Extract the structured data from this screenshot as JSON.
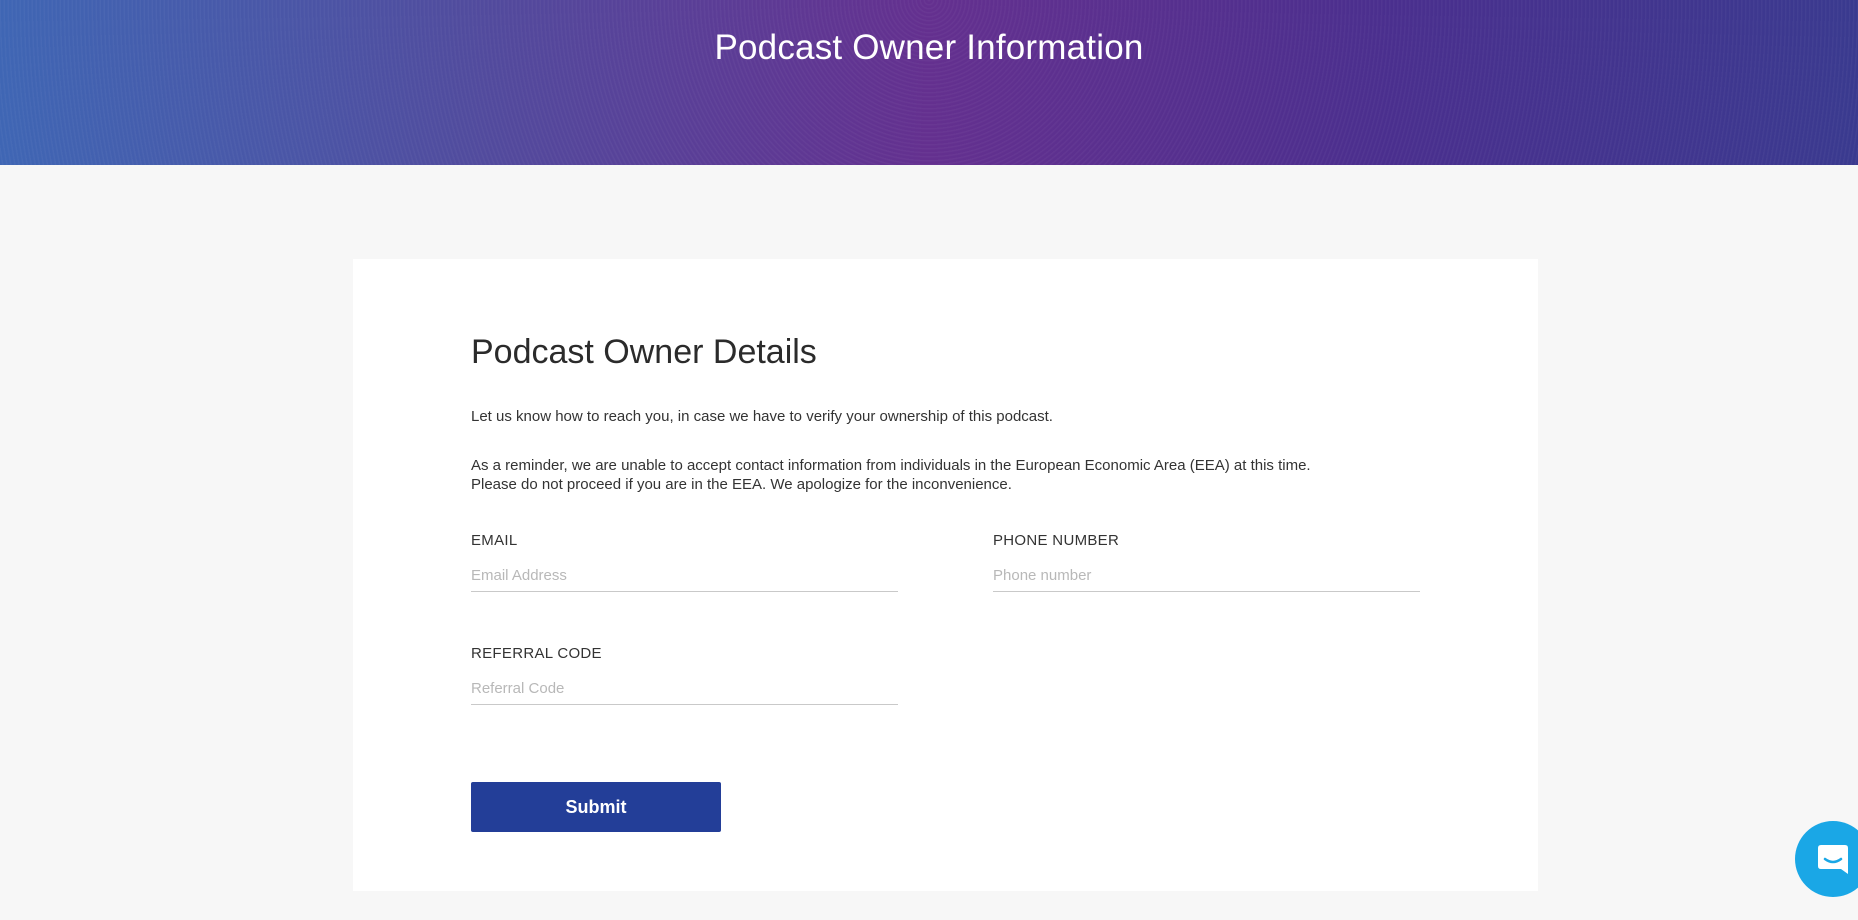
{
  "header": {
    "title": "Podcast Owner Information"
  },
  "card": {
    "title": "Podcast Owner Details",
    "intro": "Let us know how to reach you, in case we have to verify your ownership of this podcast.",
    "reminder_line1": "As a reminder, we are unable to accept contact information from individuals in the European Economic Area (EEA) at this time.",
    "reminder_line2": "Please do not proceed if you are in the EEA. We apologize for the inconvenience."
  },
  "form": {
    "email": {
      "label": "EMAIL",
      "value": "",
      "placeholder": "Email Address"
    },
    "phone": {
      "label": "PHONE NUMBER",
      "value": "",
      "placeholder": "Phone number"
    },
    "referral": {
      "label": "REFERRAL CODE",
      "value": "",
      "placeholder": "Referral Code"
    },
    "submit_label": "Submit"
  },
  "chat": {
    "icon": "chat-bubble-icon",
    "color": "#1aa7e6"
  },
  "colors": {
    "accent": "#233e98",
    "header_gradient_start": "#3f66b4",
    "header_gradient_mid": "#64308f",
    "header_gradient_end": "#3a3a8f"
  }
}
